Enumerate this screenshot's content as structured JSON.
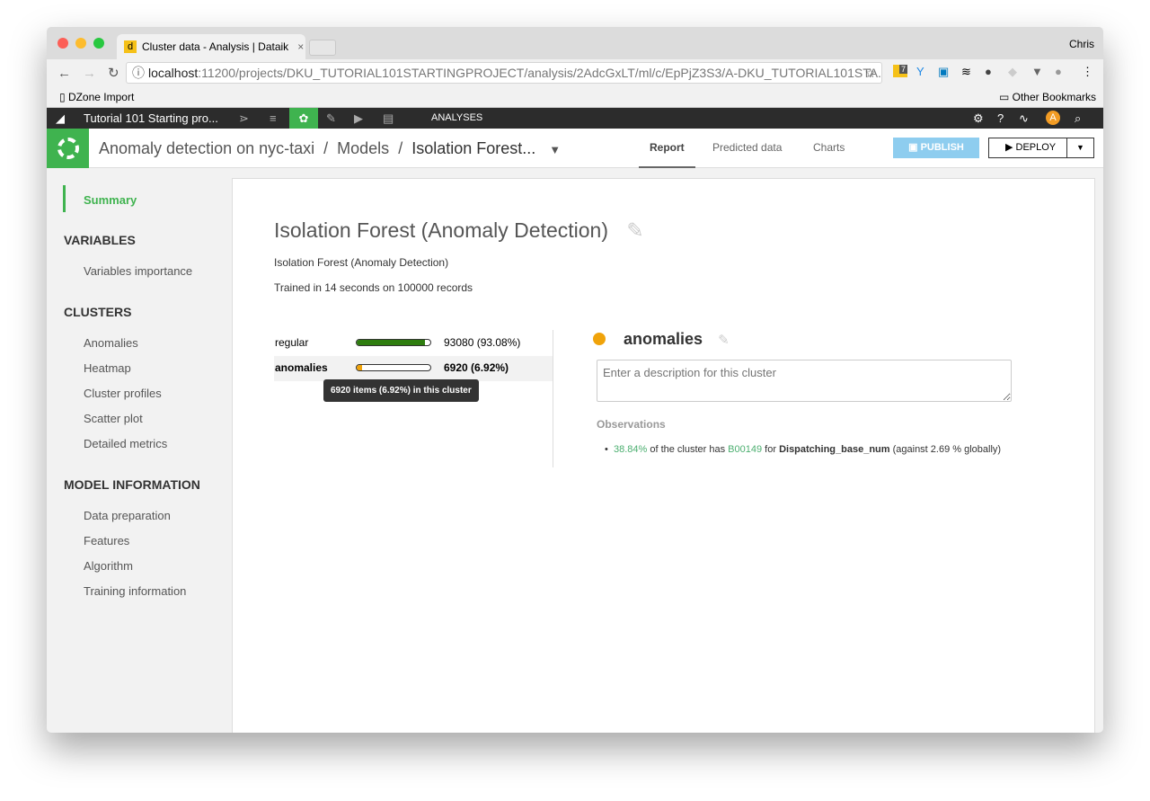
{
  "browser": {
    "tab_title": "Cluster data - Analysis | Dataik",
    "user": "Chris",
    "url_host": "localhost",
    "url_rest": ":11200/projects/DKU_TUTORIAL101STARTINGPROJECT/analysis/2AdcGxLT/ml/c/EpPjZ3S3/A-DKU_TUTORIAL101STA...",
    "bookmark": "DZone Import",
    "other_bookmarks": "Other Bookmarks",
    "ext_badge": "7"
  },
  "dss": {
    "project": "Tutorial 101 Starting pro...",
    "section": "ANALYSES",
    "avatar": "A"
  },
  "header": {
    "crumbs": [
      "Anomaly detection on nyc-taxi",
      "Models",
      "Isolation Forest..."
    ],
    "tabs": [
      "Report",
      "Predicted data",
      "Charts"
    ],
    "active_tab": "Report",
    "publish": "PUBLISH",
    "deploy": "DEPLOY"
  },
  "sidebar": {
    "summary": "Summary",
    "sections": [
      {
        "title": "VARIABLES",
        "items": [
          "Variables importance"
        ]
      },
      {
        "title": "CLUSTERS",
        "items": [
          "Anomalies",
          "Heatmap",
          "Cluster profiles",
          "Scatter plot",
          "Detailed metrics"
        ]
      },
      {
        "title": "MODEL INFORMATION",
        "items": [
          "Data preparation",
          "Features",
          "Algorithm",
          "Training information"
        ]
      }
    ]
  },
  "main": {
    "title": "Isolation Forest (Anomaly Detection)",
    "subtitle": "Isolation Forest (Anomaly Detection)",
    "trained": "Trained in 14 seconds on 100000 records",
    "clusters": [
      {
        "name": "regular",
        "value": "93080 (93.08%)",
        "fraction": 0.9308,
        "color": "#2e7d0f"
      },
      {
        "name": "anomalies",
        "value": "6920 (6.92%)",
        "fraction": 0.0692,
        "color": "#f0a30a"
      }
    ],
    "tooltip": "6920 items (6.92%) in this cluster",
    "selected": {
      "name": "anomalies",
      "color": "#f0a30a",
      "placeholder": "Enter a description for this cluster",
      "obs_title": "Observations",
      "obs": {
        "pct": "38.84%",
        "t1": " of the cluster has ",
        "val": "B00149",
        "t2": " for ",
        "feature": "Dispatching_base_num",
        "t3": " (against 2.69 % globally)"
      }
    }
  },
  "colors": {
    "green": "#3fb34f",
    "link": "#4caf70"
  }
}
